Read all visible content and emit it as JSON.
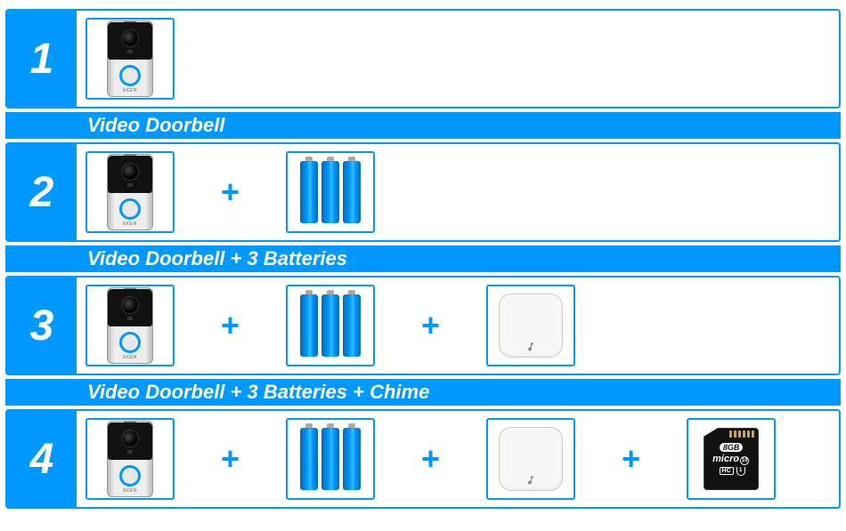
{
  "accent_color": "#0099ff",
  "plus_symbol": "+",
  "doorbell_brand": "EKEN",
  "sdcard": {
    "capacity": "8GB",
    "line1_a": "micro",
    "line1_b": "HC",
    "class_num": "10",
    "uhs": "1"
  },
  "options": [
    {
      "number": "1",
      "caption": "Video Doorbell",
      "items": [
        "doorbell"
      ]
    },
    {
      "number": "2",
      "caption": "Video Doorbell + 3 Batteries",
      "items": [
        "doorbell",
        "batteries"
      ]
    },
    {
      "number": "3",
      "caption": "Video Doorbell + 3 Batteries + Chime",
      "items": [
        "doorbell",
        "batteries",
        "chime"
      ]
    },
    {
      "number": "4",
      "caption": "",
      "items": [
        "doorbell",
        "batteries",
        "chime",
        "sdcard"
      ]
    }
  ]
}
